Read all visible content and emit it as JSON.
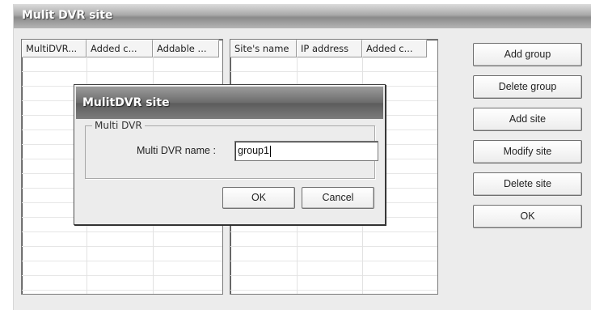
{
  "window": {
    "title": "Mulit DVR site"
  },
  "left_list": {
    "columns": [
      "MultiDVR...",
      "Added c...",
      "Addable ..."
    ]
  },
  "right_list": {
    "columns": [
      "Site's name",
      "IP address",
      "Added c..."
    ]
  },
  "buttons": {
    "add_group": "Add group",
    "delete_group": "Delete group",
    "add_site": "Add site",
    "modify_site": "Modify site",
    "delete_site": "Delete site",
    "ok": "OK"
  },
  "dialog": {
    "title": "MulitDVR site",
    "group_label": "Multi DVR",
    "field_label": "Multi DVR name :",
    "field_value": "group1",
    "ok_label": "OK",
    "cancel_label": "Cancel"
  }
}
